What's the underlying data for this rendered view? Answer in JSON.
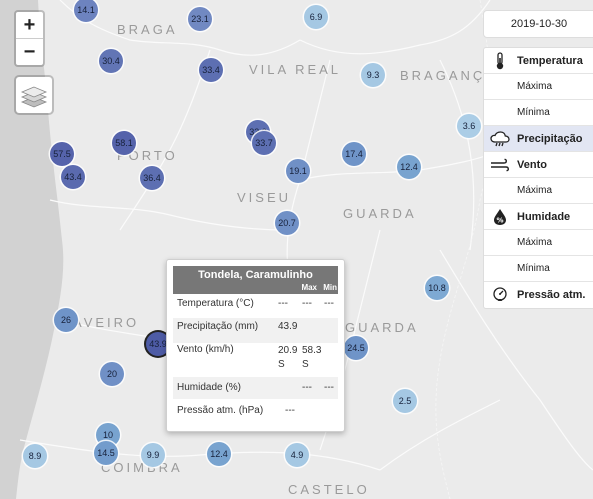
{
  "map": {
    "regions": [
      {
        "id": "braga",
        "label": "BRAGA"
      },
      {
        "id": "vila-real",
        "label": "VILA REAL"
      },
      {
        "id": "braganca",
        "label": "BRAGANÇA"
      },
      {
        "id": "porto",
        "label": "PORTO"
      },
      {
        "id": "viseu",
        "label": "VISEU"
      },
      {
        "id": "guarda-1",
        "label": "GUARDA"
      },
      {
        "id": "aveiro",
        "label": "AVEIRO"
      },
      {
        "id": "guarda-2",
        "label": "GUARDA"
      },
      {
        "id": "coimbra",
        "label": "COIMBRA"
      },
      {
        "id": "castelo",
        "label": "CASTELO"
      }
    ],
    "markers": [
      {
        "value": "14.1",
        "color": "#6d83bf"
      },
      {
        "value": "23.1",
        "color": "#7189c2"
      },
      {
        "value": "6.9",
        "color": "#a5c8e3"
      },
      {
        "value": "30.4",
        "color": "#6275b5"
      },
      {
        "value": "33.4",
        "color": "#5d6fb2"
      },
      {
        "value": "9.3",
        "color": "#a5c8e3"
      },
      {
        "value": "3.6",
        "color": "#abcde6"
      },
      {
        "value": "33.0",
        "color": "#5d6fb2"
      },
      {
        "value": "33.7",
        "color": "#5d6fb2"
      },
      {
        "value": "58.1",
        "color": "#5563ab"
      },
      {
        "value": "57.5",
        "color": "#5563ab"
      },
      {
        "value": "43.4",
        "color": "#5a6aaf"
      },
      {
        "value": "36.4",
        "color": "#5d6fb2"
      },
      {
        "value": "17.4",
        "color": "#6f94c8"
      },
      {
        "value": "12.4",
        "color": "#78a3cf"
      },
      {
        "value": "19.1",
        "color": "#7090c6"
      },
      {
        "value": "20.7",
        "color": "#7090c6"
      },
      {
        "value": "10.8",
        "color": "#7ea9d3"
      },
      {
        "value": "26",
        "color": "#6f94c8"
      },
      {
        "value": "43.9",
        "color": "#4e5ca6"
      },
      {
        "value": "24.5",
        "color": "#6f94c8"
      },
      {
        "value": "20",
        "color": "#7090c6"
      },
      {
        "value": "2.5",
        "color": "#a5c8e3"
      },
      {
        "value": "10",
        "color": "#78a3cf"
      },
      {
        "value": "14.5",
        "color": "#739ccc"
      },
      {
        "value": "8.9",
        "color": "#a5c8e3"
      },
      {
        "value": "9.9",
        "color": "#a5c8e3"
      },
      {
        "value": "12.4",
        "color": "#78a3cf"
      },
      {
        "value": "4.9",
        "color": "#a5c8e3"
      }
    ]
  },
  "zoom": {
    "in": "+",
    "out": "−"
  },
  "date": "2019-10-30",
  "menu": [
    {
      "label": "Temperatura",
      "type": "head",
      "icon": "thermometer-icon"
    },
    {
      "label": "Máxima",
      "type": "sub"
    },
    {
      "label": "Mínima",
      "type": "sub"
    },
    {
      "label": "Precipitação",
      "type": "head",
      "icon": "rain-cloud-icon",
      "active": true
    },
    {
      "label": "Vento",
      "type": "head",
      "icon": "wind-icon"
    },
    {
      "label": "Máxima",
      "type": "sub"
    },
    {
      "label": "Humidade",
      "type": "head",
      "icon": "humidity-icon"
    },
    {
      "label": "Máxima",
      "type": "sub"
    },
    {
      "label": "Mínima",
      "type": "sub"
    },
    {
      "label": "Pressão atm.",
      "type": "head",
      "icon": "gauge-icon"
    }
  ],
  "popup": {
    "station": "Tondela, Caramulinho",
    "col_max": "Max",
    "col_min": "Min",
    "rows": [
      {
        "label": "Temperatura (°C)",
        "c1": "---",
        "c2": "---",
        "c3": "---"
      },
      {
        "label": "Precipitação (mm)",
        "c1": "43.9",
        "c2": "",
        "c3": ""
      },
      {
        "label": "Vento (km/h)",
        "c1": "20.9\nS",
        "c2": "58.3\nS",
        "c3": ""
      },
      {
        "label": "Humidade (%)",
        "c1": "",
        "c2": "---",
        "c3": "---"
      },
      {
        "label": "Pressão atm. (hPa)",
        "c1": "---",
        "c2": "",
        "c3": ""
      }
    ]
  }
}
